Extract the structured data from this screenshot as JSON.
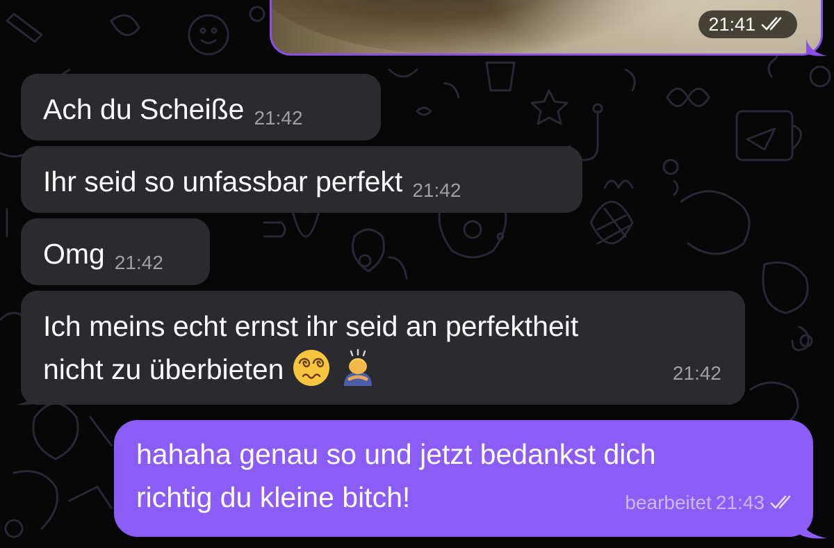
{
  "colors": {
    "background": "#070707",
    "incoming_bubble": "#2b2a2f",
    "outgoing_bubble": "#8b5df6",
    "media_border": "#8a4fe6",
    "timestamp_incoming": "#a09fa6",
    "timestamp_outgoing": "#cdb8ff"
  },
  "media_message": {
    "time": "21:41",
    "status_icon": "double-check-icon"
  },
  "messages": [
    {
      "direction": "incoming",
      "text": "Ach du Scheiße",
      "time": "21:42"
    },
    {
      "direction": "incoming",
      "text": "Ihr seid so unfassbar perfekt",
      "time": "21:42"
    },
    {
      "direction": "incoming",
      "text": "Omg",
      "time": "21:42"
    },
    {
      "direction": "incoming",
      "line1": "Ich meins echt ernst ihr seid an perfektheit",
      "line2": "nicht zu überbieten",
      "emojis": [
        "dizzy-face-emoji",
        "person-bowing-emoji"
      ],
      "time": "21:42"
    },
    {
      "direction": "outgoing",
      "line1": "hahaha genau so und jetzt bedankst dich",
      "line2": "richtig du kleine bitch!",
      "edited_label": "bearbeitet",
      "time": "21:43",
      "status_icon": "double-check-icon"
    }
  ]
}
